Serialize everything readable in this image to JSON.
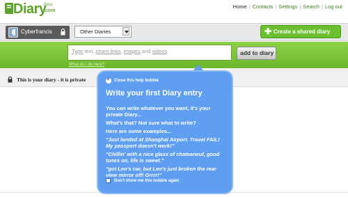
{
  "logo": {
    "text": "Diary",
    "com": ".com",
    "beta": "Beta"
  },
  "topnav": {
    "items": [
      "Home",
      "Contacts",
      "Settings",
      "Search",
      "Log out"
    ]
  },
  "user": {
    "name": "Cyberfrancis"
  },
  "diary_select": {
    "selected": "Other Diaries"
  },
  "create_button": {
    "label": "Create a shared diary"
  },
  "compose": {
    "placeholder_parts": [
      "Type",
      " text, ",
      "share links",
      ", ",
      "images",
      " and ",
      "videos",
      "."
    ],
    "add_label": "add to diary",
    "help_link": "What do I do here?"
  },
  "privacy": {
    "text": "This is your diary - it is private"
  },
  "help_bubble": {
    "close_label": "Close this help bubble",
    "title": "Write your first Diary entry",
    "intro": "You can write whatever you want, it's your private Diary...",
    "prompt": "What's that? Not sure what to write?",
    "examples_label": "Here are some examples...",
    "examples": [
      "\"Just landed at Shanghai Airport. Travel FAIL! My passport doesn't work!\"",
      "\"Chillin' with a nice glass of chateaneuf, good tunes on, life is sweet.\"",
      "\"got Leo's car, but Leo's just broken the rear view mirror off! Grrrr!\""
    ],
    "dont_show_label": "Don't show me this bubble again"
  }
}
